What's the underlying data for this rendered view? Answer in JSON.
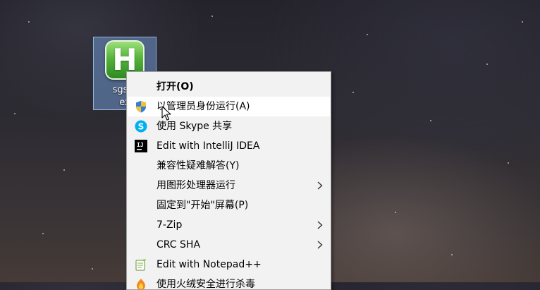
{
  "desktop": {
    "icon": {
      "glyph": "H",
      "label_line1": "sgs小",
      "label_line2": "ex"
    }
  },
  "context_menu": {
    "items": [
      {
        "label": "打开(O)",
        "icon": "none",
        "bold": true,
        "submenu": false
      },
      {
        "label": "以管理员身份运行(A)",
        "icon": "uac-shield-icon",
        "bold": false,
        "submenu": false,
        "highlighted": true
      },
      {
        "label": "使用 Skype 共享",
        "icon": "skype-icon",
        "bold": false,
        "submenu": false
      },
      {
        "label": "Edit with IntelliJ IDEA",
        "icon": "intellij-icon",
        "bold": false,
        "submenu": false
      },
      {
        "label": "兼容性疑难解答(Y)",
        "icon": "none",
        "bold": false,
        "submenu": false
      },
      {
        "label": "用图形处理器运行",
        "icon": "none",
        "bold": false,
        "submenu": true
      },
      {
        "label": "固定到\"开始\"屏幕(P)",
        "icon": "none",
        "bold": false,
        "submenu": false
      },
      {
        "label": "7-Zip",
        "icon": "none",
        "bold": false,
        "submenu": true
      },
      {
        "label": "CRC SHA",
        "icon": "none",
        "bold": false,
        "submenu": true
      },
      {
        "label": "Edit with Notepad++",
        "icon": "notepadpp-icon",
        "bold": false,
        "submenu": false
      },
      {
        "label": "使用火绒安全进行杀毒",
        "icon": "huorong-icon",
        "bold": false,
        "submenu": false
      }
    ]
  },
  "colors": {
    "menu_bg": "#f2f2f2",
    "highlight_bg": "#ffffff",
    "icon_selection": "#6e96cd",
    "app_green": "#56b33a"
  }
}
